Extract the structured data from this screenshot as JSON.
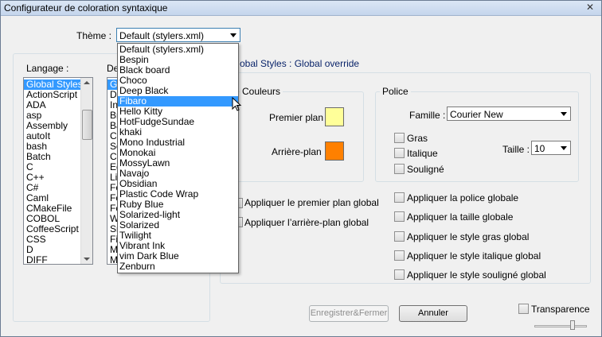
{
  "window": {
    "title": "Configurateur de coloration syntaxique",
    "close_label": "✕"
  },
  "theme": {
    "label": "Thème :",
    "selected": "Default (stylers.xml)",
    "options": [
      "Default (stylers.xml)",
      "Bespin",
      "Black board",
      "Choco",
      "Deep Black",
      "Fibaro",
      "Hello Kitty",
      "HotFudgeSundae",
      "khaki",
      "Mono Industrial",
      "Monokai",
      "MossyLawn",
      "Navajo",
      "Obsidian",
      "Plastic Code Wrap",
      "Ruby Blue",
      "Solarized-light",
      "Solarized",
      "Twilight",
      "Vibrant Ink",
      "vim Dark Blue",
      "Zenburn"
    ],
    "highlighted": "Fibaro"
  },
  "language": {
    "label": "Langage :",
    "items": [
      "Global Styles",
      "ActionScript",
      "ADA",
      "asp",
      "Assembly",
      "autoIt",
      "bash",
      "Batch",
      "C",
      "C++",
      "C#",
      "Caml",
      "CMakeFile",
      "COBOL",
      "CoffeeScript",
      "CSS",
      "D",
      "DIFF"
    ],
    "selected": "Global Styles"
  },
  "style": {
    "label_partial": "De",
    "items_partial": [
      "G",
      "D",
      "In",
      "Br",
      "Ba",
      "C",
      "Se",
      "C",
      "Ed",
      "Li",
      "Fo",
      "Fo",
      "Fo",
      "W",
      "Sn",
      "Fi",
      "M",
      "M"
    ]
  },
  "breadcrumb": "obal Styles : Global override",
  "colors": {
    "group_title": "Couleurs",
    "foreground_label": "Premier plan",
    "foreground_color": "#ffff99",
    "background_label": "Arrière-plan",
    "background_color": "#ff8000"
  },
  "font": {
    "group_title": "Police",
    "family_label": "Famille :",
    "family_value": "Courier New",
    "bold_label": "Gras",
    "italic_label": "Italique",
    "underline_label": "Souligné",
    "size_label": "Taille :",
    "size_value": "10"
  },
  "global_options": {
    "apply_fg": "Appliquer le premier plan global",
    "apply_bg": "Appliquer l’arrière-plan global",
    "apply_font": "Appliquer la police globale",
    "apply_size": "Appliquer la taille globale",
    "apply_bold": "Appliquer le style gras global",
    "apply_italic": "Appliquer le style italique global",
    "apply_underline": "Appliquer le style souligné global"
  },
  "buttons": {
    "save_close": "Enregistrer&Fermer",
    "cancel": "Annuler"
  },
  "transparency": {
    "label": "Transparence",
    "level": 0.75
  },
  "colors_ui": {
    "selection": "#3399ff",
    "focus_border": "#3c7fb1"
  }
}
